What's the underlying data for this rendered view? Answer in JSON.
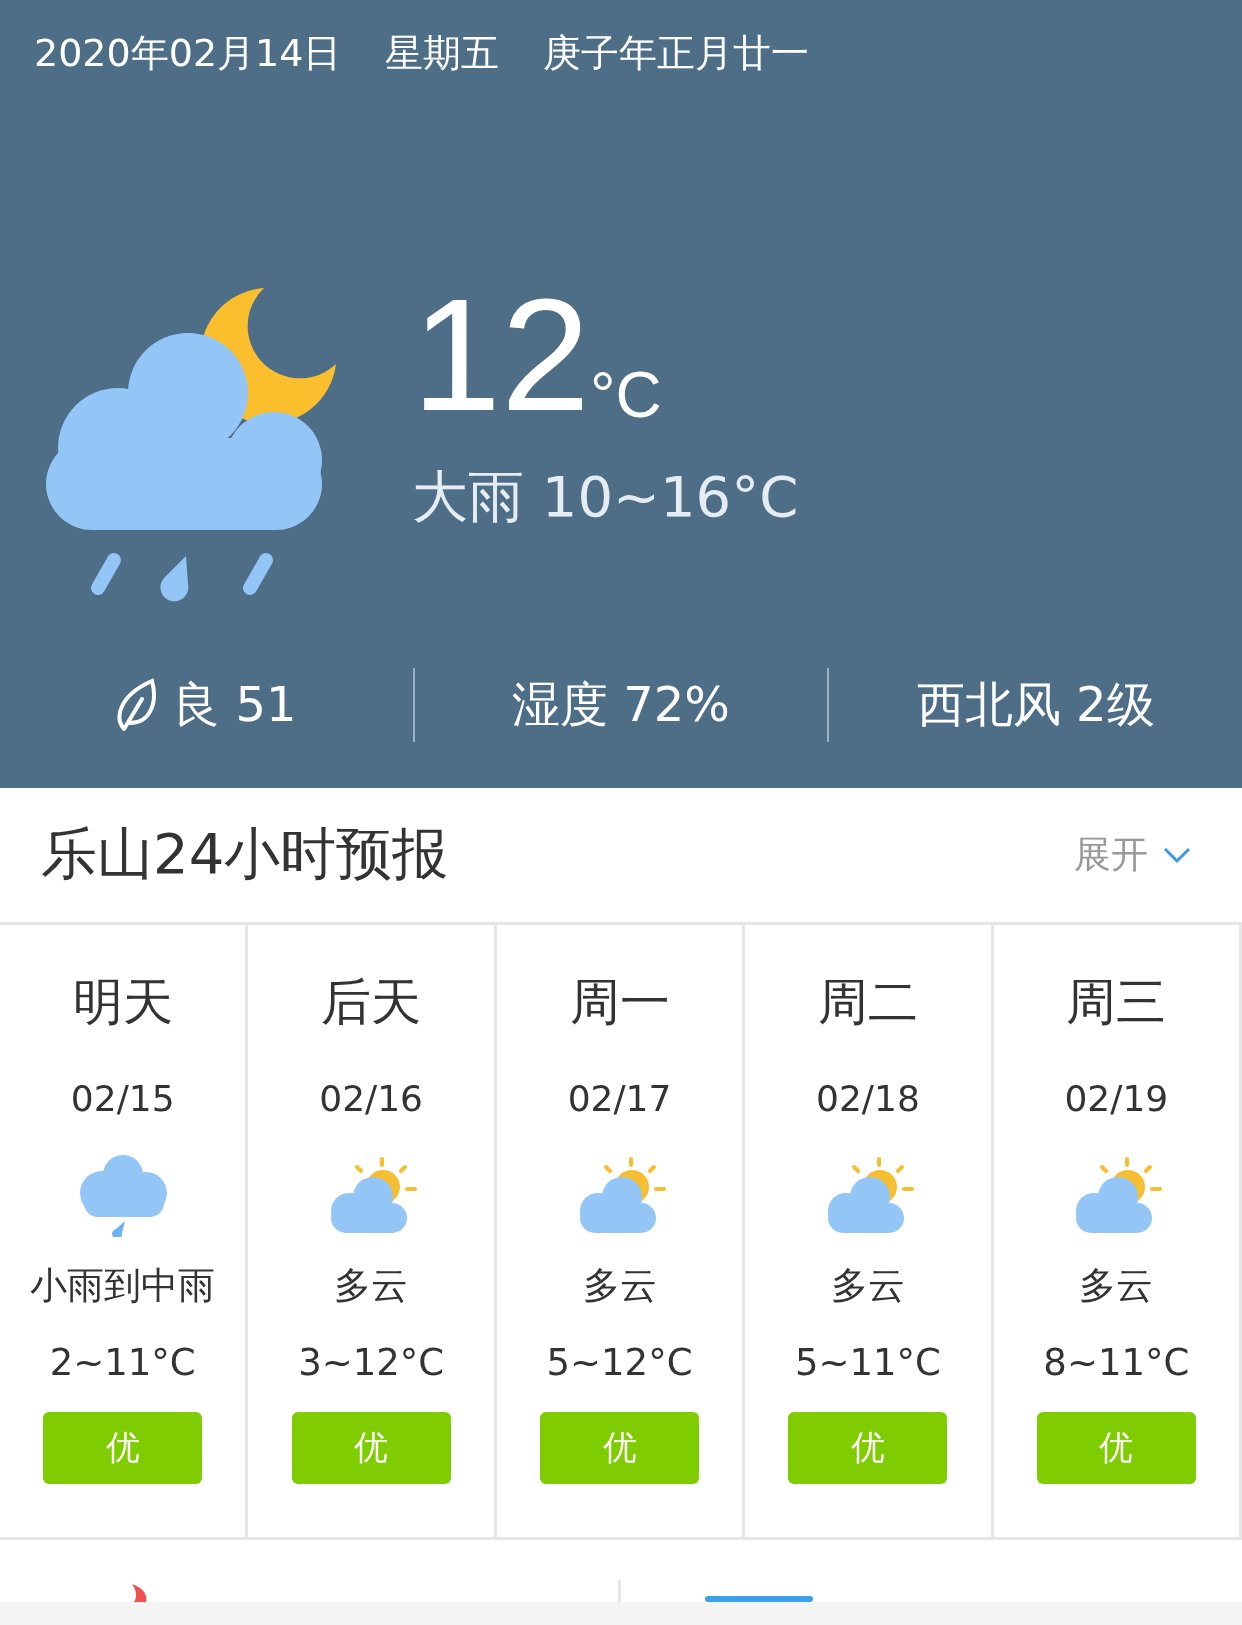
{
  "header": {
    "date": "2020年02月14日",
    "weekday": "星期五",
    "lunar": "庚子年正月廿一",
    "temperature": "12",
    "unit": "°C",
    "summary": "大雨 10~16°C",
    "stats": [
      {
        "kind": "air",
        "label": "良 51"
      },
      {
        "kind": "plain",
        "label": "湿度 72%"
      },
      {
        "kind": "plain",
        "label": "西北风 2级"
      }
    ]
  },
  "forecast": {
    "title": "乐山24小时预报",
    "toggle": "展开",
    "days": [
      {
        "day": "明天",
        "date": "02/15",
        "kind": "rain",
        "weather": "小雨到中雨",
        "temp": "2~11°C",
        "aqi": "优"
      },
      {
        "day": "后天",
        "date": "02/16",
        "kind": "partly",
        "weather": "多云",
        "temp": "3~12°C",
        "aqi": "优"
      },
      {
        "day": "周一",
        "date": "02/17",
        "kind": "partly",
        "weather": "多云",
        "temp": "5~12°C",
        "aqi": "优"
      },
      {
        "day": "周二",
        "date": "02/18",
        "kind": "partly",
        "weather": "多云",
        "temp": "5~11°C",
        "aqi": "优"
      },
      {
        "day": "周三",
        "date": "02/19",
        "kind": "partly",
        "weather": "多云",
        "temp": "8~11°C",
        "aqi": "优"
      }
    ]
  }
}
